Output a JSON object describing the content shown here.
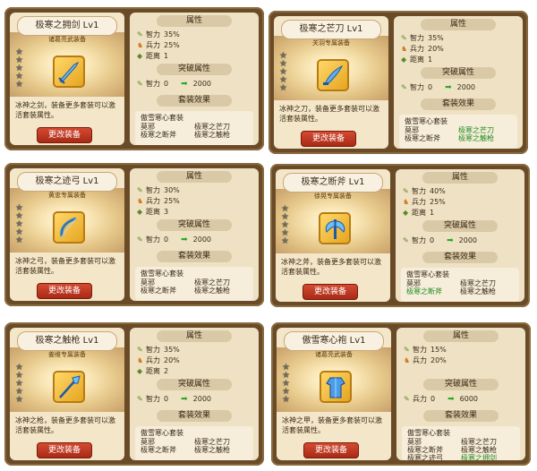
{
  "labels": {
    "attr_title": "属性",
    "break_title": "突破属性",
    "set_title": "套装效果",
    "change_button": "更改装备",
    "stat_int": "智力",
    "stat_troops": "兵力",
    "stat_range": "距离",
    "set_name": "傲雪寒心套装"
  },
  "cards": [
    {
      "title": "极寒之拥剑  Lv1",
      "quality": "诸葛亮武装备",
      "desc": "冰神之剑，装备更多套装可以激活套装属性。",
      "stats": [
        {
          "label": "智力",
          "value": "35%"
        },
        {
          "label": "兵力",
          "value": "25%"
        },
        {
          "label": "距离",
          "value": "1"
        }
      ],
      "break": {
        "label": "智力",
        "from": "0",
        "to": "2000"
      },
      "set_items": [
        {
          "name": "莫邪",
          "active": false
        },
        {
          "name": "极寒之芒刀",
          "active": false
        },
        {
          "name": "极寒之断斧",
          "active": false
        },
        {
          "name": "极寒之触枪",
          "active": false
        }
      ]
    },
    {
      "title": "极寒之芒刀  Lv1",
      "quality": "关羽专属装备",
      "desc": "冰神之刀，装备更多套装可以激活套装属性。",
      "stats": [
        {
          "label": "智力",
          "value": "35%"
        },
        {
          "label": "兵力",
          "value": "20%"
        },
        {
          "label": "距离",
          "value": "1"
        }
      ],
      "break": {
        "label": "智力",
        "from": "0",
        "to": "2000"
      },
      "set_items": [
        {
          "name": "莫邪",
          "active": false
        },
        {
          "name": "极寒之芒刀",
          "active": true
        },
        {
          "name": "极寒之断斧",
          "active": false
        },
        {
          "name": "极寒之触枪",
          "active": true
        }
      ]
    },
    {
      "title": "极寒之迹弓  Lv1",
      "quality": "黄忠专属装备",
      "desc": "冰神之弓，装备更多套装可以激活套装属性。",
      "stats": [
        {
          "label": "智力",
          "value": "30%"
        },
        {
          "label": "兵力",
          "value": "25%"
        },
        {
          "label": "距离",
          "value": "3"
        }
      ],
      "break": {
        "label": "智力",
        "from": "0",
        "to": "2000"
      },
      "set_items": [
        {
          "name": "莫邪",
          "active": false
        },
        {
          "name": "极寒之芒刀",
          "active": false
        },
        {
          "name": "极寒之断斧",
          "active": false
        },
        {
          "name": "极寒之触枪",
          "active": false
        }
      ]
    },
    {
      "title": "极寒之断斧  Lv1",
      "quality": "徐晃专属装备",
      "desc": "冰神之斧，装备更多套装可以激活套装属性。",
      "stats": [
        {
          "label": "智力",
          "value": "40%"
        },
        {
          "label": "兵力",
          "value": "25%"
        },
        {
          "label": "距离",
          "value": "1"
        }
      ],
      "break": {
        "label": "智力",
        "from": "0",
        "to": "2000"
      },
      "set_items": [
        {
          "name": "莫邪",
          "active": false
        },
        {
          "name": "极寒之芒刀",
          "active": false
        },
        {
          "name": "极寒之断斧",
          "active": true
        },
        {
          "name": "极寒之触枪",
          "active": false
        }
      ]
    },
    {
      "title": "极寒之触枪  Lv1",
      "quality": "姜维专属装备",
      "desc": "冰神之枪，装备更多套装可以激活套装属性。",
      "stats": [
        {
          "label": "智力",
          "value": "35%"
        },
        {
          "label": "兵力",
          "value": "20%"
        },
        {
          "label": "距离",
          "value": "2"
        }
      ],
      "break": {
        "label": "智力",
        "from": "0",
        "to": "2000"
      },
      "set_items": [
        {
          "name": "莫邪",
          "active": false
        },
        {
          "name": "极寒之芒刀",
          "active": false
        },
        {
          "name": "极寒之断斧",
          "active": false
        },
        {
          "name": "极寒之触枪",
          "active": false
        }
      ]
    },
    {
      "title": "傲雪寒心袍  Lv1",
      "quality": "诸葛亮武装备",
      "desc": "冰神之甲，装备更多套装可以激活套装属性。",
      "stats": [
        {
          "label": "智力",
          "value": "15%"
        },
        {
          "label": "兵力",
          "value": "20%"
        }
      ],
      "break": {
        "label": "兵力",
        "from": "0",
        "to": "6000"
      },
      "set_items": [
        {
          "name": "莫邪",
          "active": false
        },
        {
          "name": "极寒之芒刀",
          "active": false
        },
        {
          "name": "极寒之断斧",
          "active": false
        },
        {
          "name": "极寒之触枪",
          "active": false
        },
        {
          "name": "极寒之迹弓",
          "active": false
        },
        {
          "name": "极寒之拥剑",
          "active": true
        }
      ]
    }
  ]
}
